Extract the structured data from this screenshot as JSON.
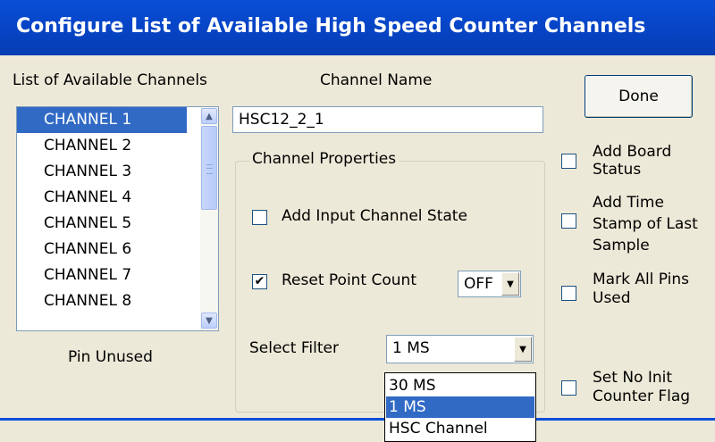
{
  "window": {
    "title": "Configure List of Available High Speed Counter Channels"
  },
  "channels_list": {
    "label": "List of Available Channels",
    "items": [
      "CHANNEL 1",
      "CHANNEL 2",
      "CHANNEL 3",
      "CHANNEL 4",
      "CHANNEL 5",
      "CHANNEL 6",
      "CHANNEL 7",
      "CHANNEL 8"
    ],
    "selected": "CHANNEL 1",
    "pin_status": "Pin Unused"
  },
  "channel_name": {
    "label": "Channel Name",
    "value": "HSC12_2_1"
  },
  "done_button": {
    "label": "Done"
  },
  "channel_properties": {
    "label": "Channel Properties",
    "add_input_state": {
      "label": "Add Input Channel State",
      "checked": false,
      "mark": ""
    },
    "reset_point_count": {
      "label": "Reset Point Count",
      "checked": true,
      "mark": "✔",
      "combo_value": "OFF"
    },
    "select_filter": {
      "label": "Select Filter",
      "value": "1 MS",
      "dropdown_options": [
        "30 MS",
        "1 MS",
        "HSC Channel"
      ],
      "highlighted": "1 MS"
    }
  },
  "options": {
    "add_board_status": {
      "label_line1": "Add Board",
      "label_line2": "Status",
      "checked": false
    },
    "add_time_stamp": {
      "label_line1": "Add Time",
      "label_line2": "Stamp of Last",
      "label_line3": "Sample",
      "checked": false
    },
    "mark_all_pins": {
      "label_line1": "Mark All Pins",
      "label_line2": "Used",
      "checked": false
    },
    "set_no_init": {
      "label_line1": "Set No Init",
      "label_line2": "Counter Flag",
      "checked": false
    }
  },
  "icons": {
    "scroll_up": "chevron-up-icon",
    "scroll_down": "chevron-down-icon",
    "combo_arrow": "caret-down-icon"
  },
  "colors": {
    "titlebar": "#0746c9",
    "selection": "#316ac5",
    "background": "#ece9d8"
  }
}
